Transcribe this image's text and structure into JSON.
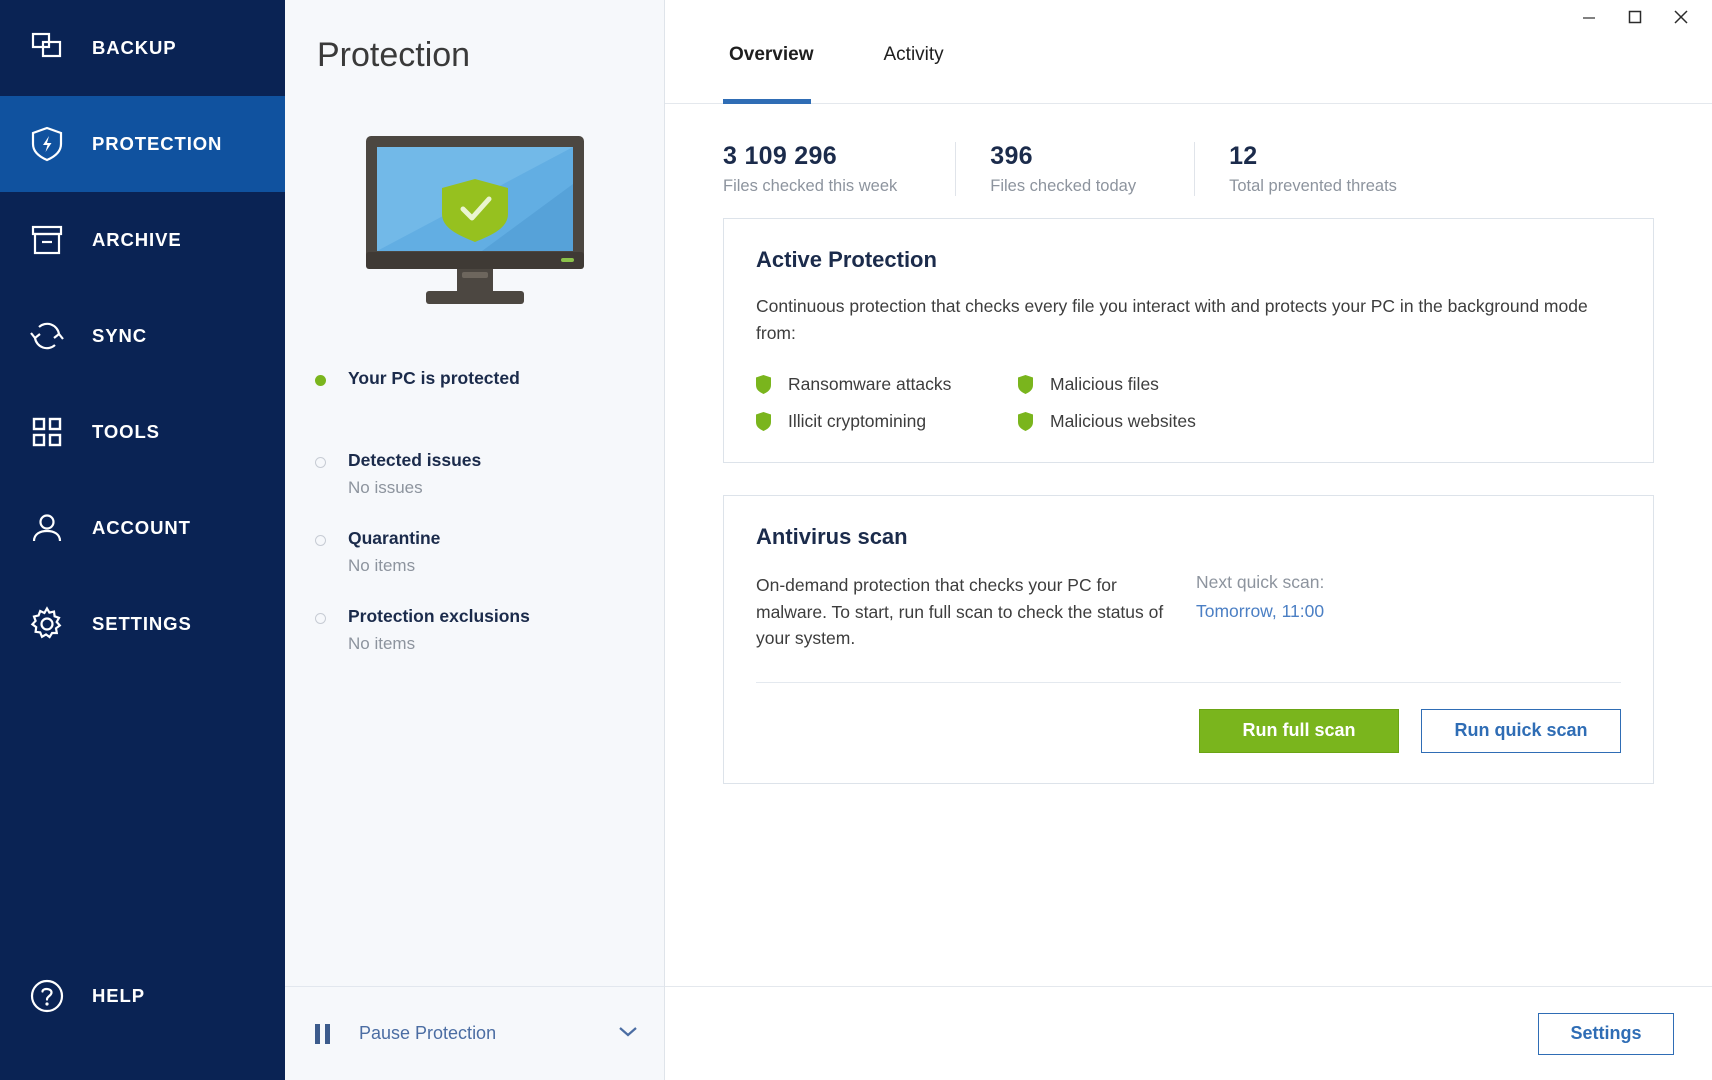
{
  "window": {
    "controls": [
      {
        "name": "minimize",
        "glyph": "minimize-icon"
      },
      {
        "name": "maximize",
        "glyph": "maximize-icon"
      },
      {
        "name": "close",
        "glyph": "close-icon"
      }
    ]
  },
  "sidebar": {
    "items": [
      {
        "label": "BACKUP",
        "icon": "copies-icon",
        "active": false
      },
      {
        "label": "PROTECTION",
        "icon": "shield-bolt-icon",
        "active": true
      },
      {
        "label": "ARCHIVE",
        "icon": "archive-box-icon",
        "active": false
      },
      {
        "label": "SYNC",
        "icon": "sync-arrows-icon",
        "active": false
      },
      {
        "label": "TOOLS",
        "icon": "grid-squares-icon",
        "active": false
      },
      {
        "label": "ACCOUNT",
        "icon": "person-icon",
        "active": false
      },
      {
        "label": "SETTINGS",
        "icon": "gear-icon",
        "active": false
      }
    ],
    "help": {
      "label": "HELP",
      "icon": "question-circle-icon"
    },
    "colors": {
      "background": "#0a2354",
      "active": "#10529f",
      "text": "#ffffff"
    }
  },
  "middle": {
    "title": "Protection",
    "illustration": {
      "name": "protected-pc-monitor",
      "screen_color": "#62aee3",
      "shield_color": "#96c11f",
      "frame_color": "#4c4741"
    },
    "status": [
      {
        "title": "Your PC is protected",
        "sub": "",
        "dot": "green"
      },
      {
        "title": "Detected issues",
        "sub": "No issues",
        "dot": "empty"
      },
      {
        "title": "Quarantine",
        "sub": "No items",
        "dot": "empty"
      },
      {
        "title": "Protection exclusions",
        "sub": "No items",
        "dot": "empty"
      }
    ],
    "pause": {
      "label": "Pause Protection",
      "icon": "pause-icon",
      "chevron": "chevron-down-icon"
    }
  },
  "main": {
    "tabs": [
      {
        "label": "Overview",
        "active": true
      },
      {
        "label": "Activity",
        "active": false
      }
    ],
    "stats": [
      {
        "value": "3 109 296",
        "label": "Files checked this week"
      },
      {
        "value": "396",
        "label": "Files checked today"
      },
      {
        "value": "12",
        "label": "Total prevented threats"
      }
    ],
    "active_protection": {
      "title": "Active Protection",
      "description": "Continuous protection that checks every file you interact with and protects your PC in the background mode from:",
      "features": [
        {
          "label": "Ransomware attacks",
          "icon": "shield-small-icon"
        },
        {
          "label": "Malicious files",
          "icon": "shield-small-icon"
        },
        {
          "label": "Illicit cryptomining",
          "icon": "shield-small-icon"
        },
        {
          "label": "Malicious websites",
          "icon": "shield-small-icon"
        }
      ]
    },
    "antivirus_scan": {
      "title": "Antivirus scan",
      "description": "On-demand protection that checks your PC for malware. To start, run full scan to check the status of your system.",
      "next_scan_label": "Next quick scan:",
      "next_scan_value": "Tomorrow, 11:00",
      "run_full_label": "Run full scan",
      "run_quick_label": "Run quick scan"
    },
    "footer": {
      "settings_label": "Settings"
    }
  },
  "colors": {
    "accent_blue": "#2f6db5",
    "accent_green": "#7ab51d",
    "link_blue": "#4b7fc4",
    "sidebar_navy": "#0a2354",
    "muted_text": "#8d949e"
  }
}
